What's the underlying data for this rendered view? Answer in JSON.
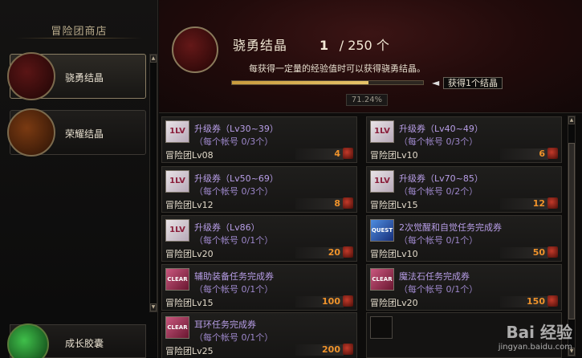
{
  "sidebar": {
    "title": "冒险团商店",
    "items": [
      {
        "label": "骁勇结晶",
        "icon": "fist-crystal-icon",
        "active": true
      },
      {
        "label": "荣耀结晶",
        "icon": "trophy-icon",
        "active": false
      },
      {
        "label": "成长胶囊",
        "icon": "growth-capsule-icon",
        "active": false
      }
    ]
  },
  "header": {
    "currency_name": "骁勇结晶",
    "count_current": "1",
    "count_max": "/ 250 个",
    "description": "每获得一定量的经验值时可以获得骁勇结晶。",
    "progress_percent": 71.24,
    "progress_label": "71.24%",
    "progress_tip": "获得1个结晶",
    "arrow": "◄"
  },
  "items": [
    {
      "name": "升级券（Lv30~39）",
      "limit": "（每个帐号 0/3个）",
      "req": "冒险团Lv08",
      "price": "4",
      "icon": "1lv"
    },
    {
      "name": "升级券（Lv40~49）",
      "limit": "（每个帐号 0/3个）",
      "req": "冒险团Lv10",
      "price": "6",
      "icon": "1lv"
    },
    {
      "name": "升级券（Lv50~69）",
      "limit": "（每个帐号 0/3个）",
      "req": "冒险团Lv12",
      "price": "8",
      "icon": "1lv"
    },
    {
      "name": "升级券（Lv70~85）",
      "limit": "（每个帐号 0/2个）",
      "req": "冒险团Lv15",
      "price": "12",
      "icon": "1lv"
    },
    {
      "name": "升级券（Lv86）",
      "limit": "（每个帐号 0/1个）",
      "req": "冒险团Lv20",
      "price": "20",
      "icon": "1lv"
    },
    {
      "name": "2次觉醒和自觉任务完成券",
      "limit": "（每个帐号 0/1个）",
      "req": "冒险团Lv10",
      "price": "50",
      "icon": "blue"
    },
    {
      "name": "辅助装备任务完成券",
      "limit": "（每个帐号 0/1个）",
      "req": "冒险团Lv15",
      "price": "100",
      "icon": "clear"
    },
    {
      "name": "魔法石任务完成券",
      "limit": "（每个帐号 0/1个）",
      "req": "冒险团Lv20",
      "price": "150",
      "icon": "clear"
    },
    {
      "name": "耳环任务完成券",
      "limit": "（每个帐号 0/1个）",
      "req": "冒险团Lv25",
      "price": "200",
      "icon": "clear"
    }
  ],
  "icon_text": {
    "lv": "1LV",
    "clear": "CLEAR",
    "blue": "QUEST"
  },
  "scroll": {
    "up": "▲",
    "down": "▼"
  },
  "watermark": {
    "brand": "Bai 经验",
    "url": "jingyan.baidu.com"
  }
}
